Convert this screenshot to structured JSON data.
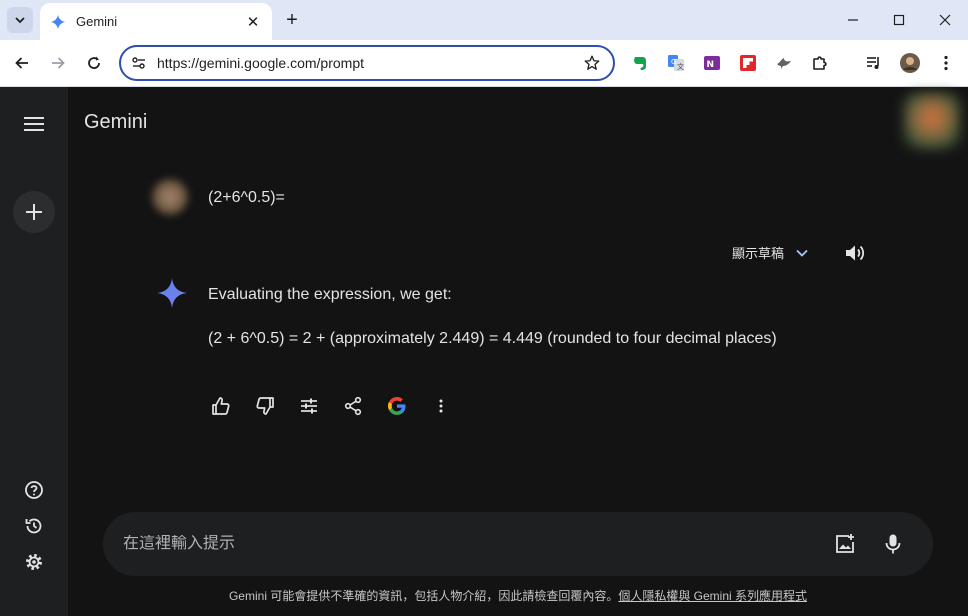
{
  "browser": {
    "tab_title": "Gemini",
    "url": "https://gemini.google.com/prompt"
  },
  "app": {
    "title": "Gemini"
  },
  "conversation": {
    "user_prompt": "(2+6^0.5)=",
    "drafts_label": "顯示草稿",
    "response": {
      "line1": "Evaluating the expression, we get:",
      "line2": "(2 + 6^0.5) = 2 + (approximately 2.449) = 4.449 (rounded to four decimal places)"
    }
  },
  "input": {
    "placeholder": "在這裡輸入提示"
  },
  "footer": {
    "disclaimer": "Gemini 可能會提供不準確的資訊，包括人物介紹，因此請檢查回覆內容。",
    "privacy_link": "個人隱私權與 Gemini 系列應用程式"
  },
  "colors": {
    "accent_blue": "#4285f4",
    "background": "#131314",
    "sidebar": "#1e1f20"
  }
}
